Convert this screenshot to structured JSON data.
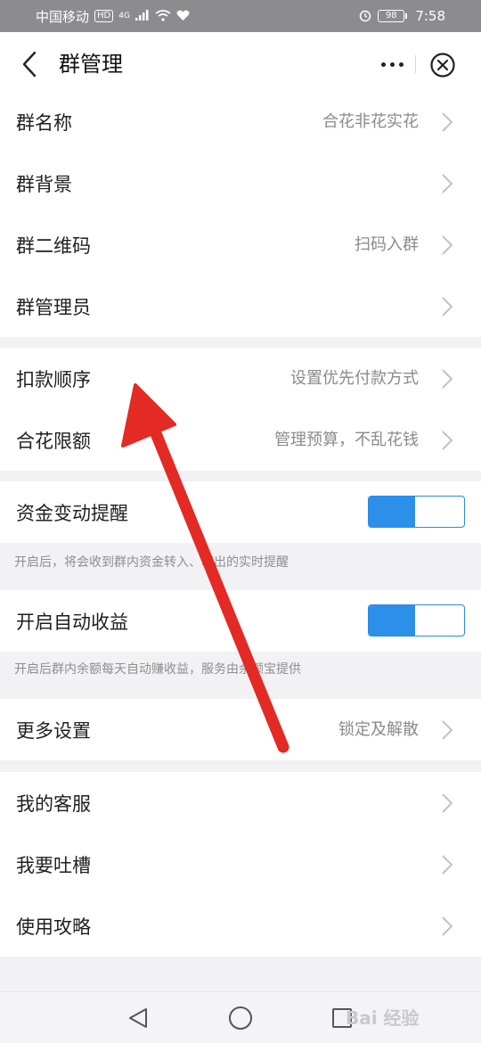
{
  "status_bar": {
    "carrier": "中国移动",
    "network_badge": "HD",
    "network_type": "4G",
    "battery": "98",
    "time": "7:58",
    "icons": [
      "signal-icon",
      "wifi-icon",
      "heart-icon",
      "alarm-icon",
      "battery-icon"
    ]
  },
  "header": {
    "title": "群管理",
    "icons": [
      "back-arrow-icon",
      "more-dots-icon",
      "close-circle-icon"
    ]
  },
  "groups": [
    {
      "rows": [
        {
          "label": "群名称",
          "value": "合花非花实花"
        },
        {
          "label": "群背景",
          "value": ""
        },
        {
          "label": "群二维码",
          "value": "扫码入群"
        },
        {
          "label": "群管理员",
          "value": ""
        }
      ]
    },
    {
      "rows": [
        {
          "label": "扣款顺序",
          "value": "设置优先付款方式"
        },
        {
          "label": "合花限额",
          "value": "管理预算，不乱花钱"
        }
      ]
    }
  ],
  "toggles": [
    {
      "label": "资金变动提醒",
      "on": true,
      "note": "开启后，将会收到群内资金转入、转出的实时提醒"
    },
    {
      "label": "开启自动收益",
      "on": true,
      "note": "开启后群内余额每天自动赚收益，服务由余额宝提供"
    }
  ],
  "more_settings": {
    "label": "更多设置",
    "value": "锁定及解散"
  },
  "support": {
    "rows": [
      {
        "label": "我的客服"
      },
      {
        "label": "我要吐槽"
      },
      {
        "label": "使用攻略"
      }
    ]
  },
  "watermark": "Bai 经验",
  "colors": {
    "toggle_blue": "#2c8fe9",
    "annotation_red": "#e32a25",
    "background": "#f2f2f4"
  }
}
